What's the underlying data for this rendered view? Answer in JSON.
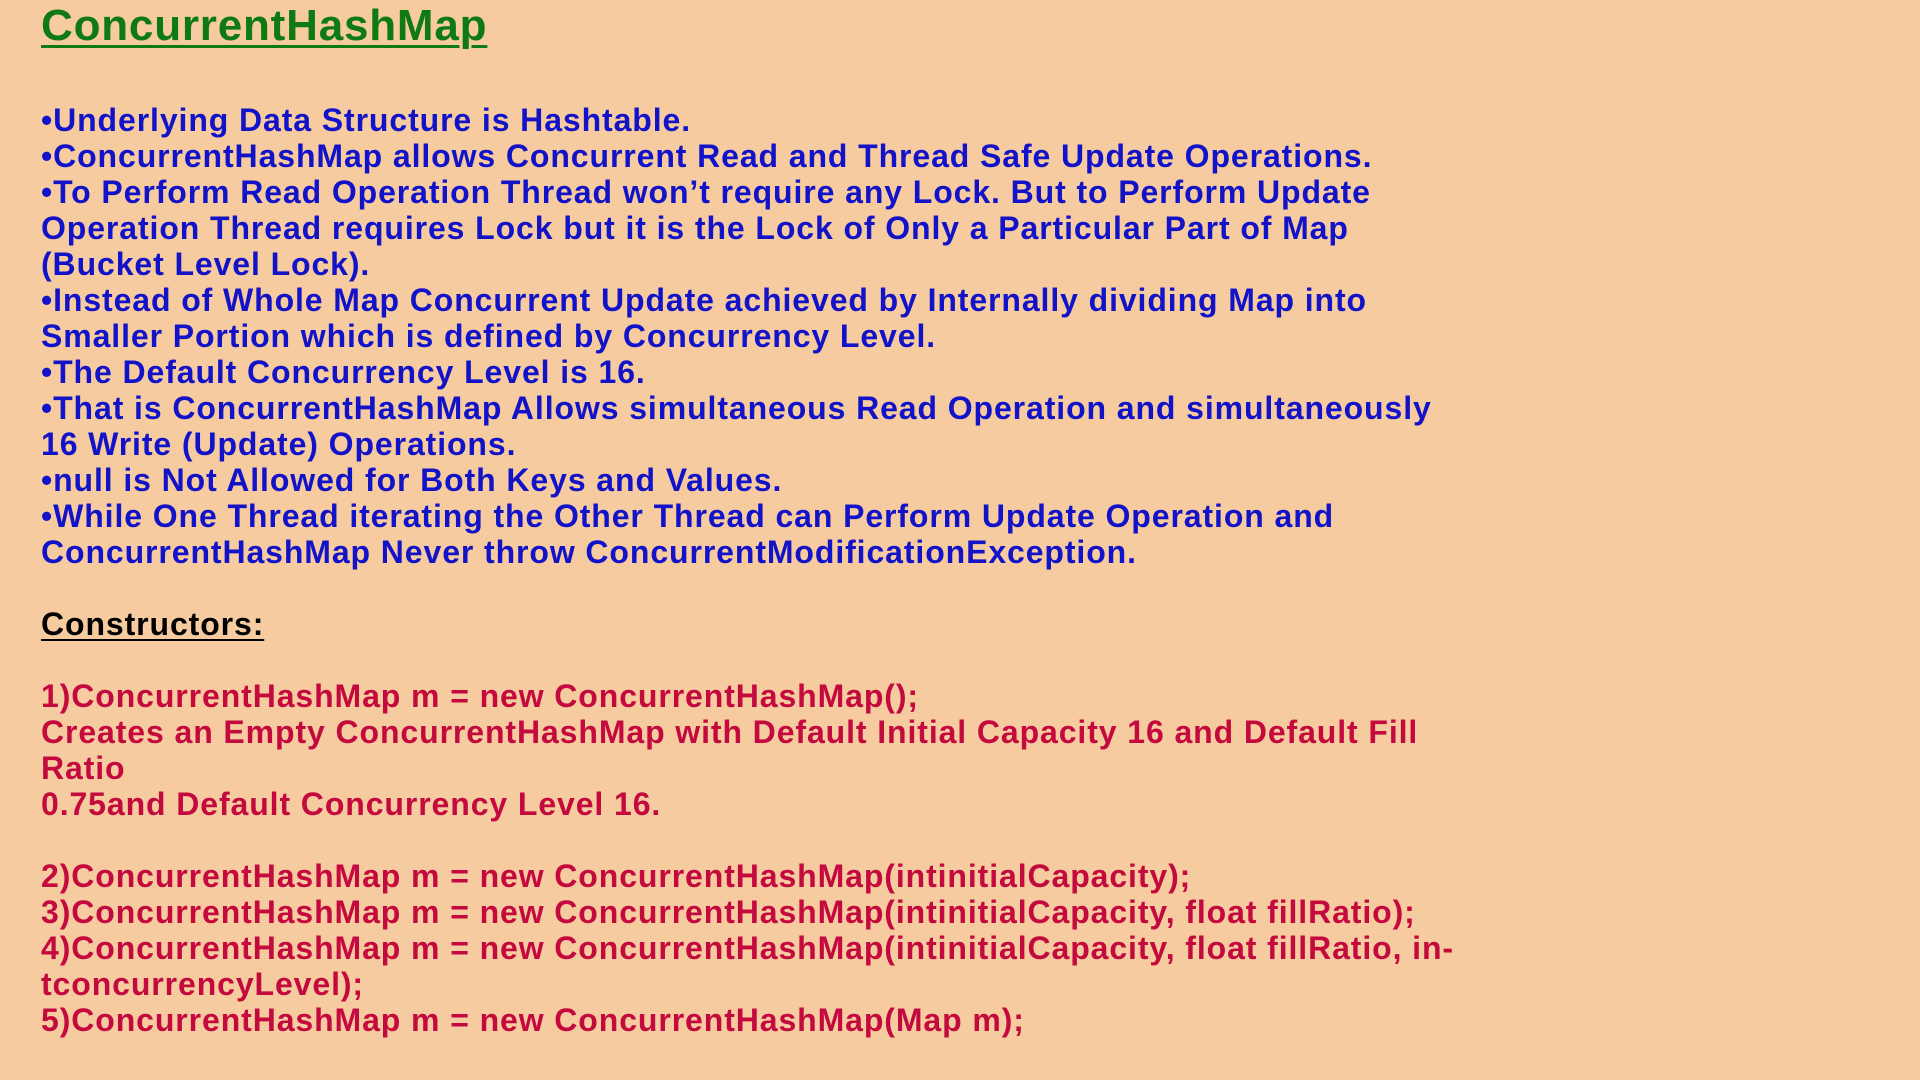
{
  "title": "ConcurrentHashMap",
  "bullets_lines": [
    "•Underlying Data Structure is Hashtable.",
    "•ConcurrentHashMap allows Concurrent Read and Thread Safe Update Operations.",
    "•To Perform Read Operation Thread won’t require any Lock. But to Perform Update",
    "Operation Thread requires Lock but it is the Lock of Only a Particular Part of Map",
    "(Bucket Level Lock).",
    "•Instead of Whole Map Concurrent Update achieved by Internally dividing Map into",
    "Smaller Portion which is defined by Concurrency Level.",
    "•The Default Concurrency Level is 16.",
    "•That is ConcurrentHashMap Allows simultaneous Read Operation and simultaneously",
    "16 Write (Update) Operations.",
    "•null is Not Allowed for Both Keys and Values.",
    "•While One Thread iterating the Other Thread can Perform Update Operation and",
    "ConcurrentHashMap Never throw ConcurrentModificationException."
  ],
  "constructors_heading": "Constructors:",
  "constructor1_lines": [
    "1)ConcurrentHashMap m = new ConcurrentHashMap();",
    "Creates an Empty ConcurrentHashMap with Default Initial Capacity 16 and Default Fill",
    "Ratio",
    "0.75and Default Concurrency Level 16."
  ],
  "constructors_rest_lines": [
    "2)ConcurrentHashMap m = new ConcurrentHashMap(intinitialCapacity);",
    "3)ConcurrentHashMap m = new ConcurrentHashMap(intinitialCapacity, float fillRatio);",
    "4)ConcurrentHashMap m = new ConcurrentHashMap(intinitialCapacity, float fillRatio, in-",
    "tconcurrencyLevel);",
    "5)ConcurrentHashMap m = new ConcurrentHashMap(Map m);"
  ],
  "colors": {
    "background": "#f5cb9f",
    "title": "#0f7a14",
    "bullets": "#1212c8",
    "heading": "#000000",
    "constructors": "#c4093f"
  }
}
